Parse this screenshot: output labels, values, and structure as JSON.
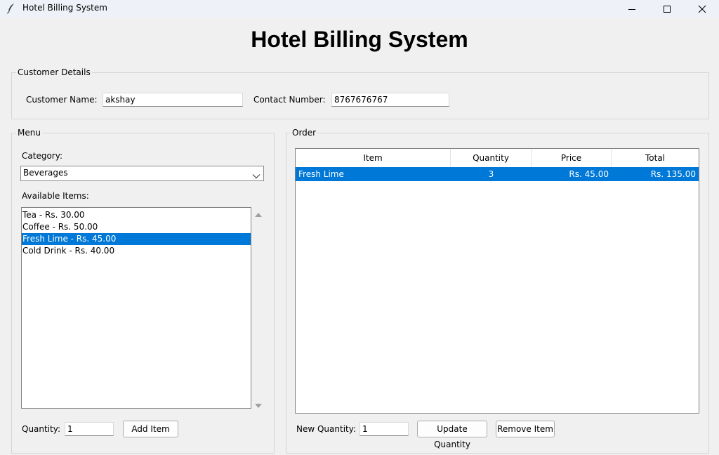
{
  "window": {
    "title": "Hotel Billing System"
  },
  "heading": "Hotel Billing System",
  "customer": {
    "group_label": "Customer Details",
    "name_label": "Customer Name:",
    "name_value": "akshay",
    "contact_label": "Contact Number:",
    "contact_value": "8767676767"
  },
  "menu": {
    "group_label": "Menu",
    "category_label": "Category:",
    "category_value": "Beverages",
    "available_label": "Available Items:",
    "items": [
      "Tea - Rs. 30.00",
      "Coffee - Rs. 50.00",
      "Fresh Lime - Rs. 45.00",
      "Cold Drink - Rs. 40.00"
    ],
    "selected_index": 2,
    "quantity_label": "Quantity:",
    "quantity_value": "1",
    "add_button": "Add Item"
  },
  "order": {
    "group_label": "Order",
    "columns": [
      "Item",
      "Quantity",
      "Price",
      "Total"
    ],
    "rows": [
      {
        "item": "Fresh Lime",
        "quantity": "3",
        "price": "Rs. 45.00",
        "total": "Rs. 135.00"
      }
    ],
    "new_quantity_label": "New Quantity:",
    "new_quantity_value": "1",
    "update_button": "Update Quantity",
    "remove_button": "Remove Item"
  },
  "colors": {
    "selection": "#0078d7",
    "window_bg": "#f0f0f0",
    "titlebar_bg": "#eef2f8"
  },
  "icons": [
    "feather-icon",
    "minimize-icon",
    "maximize-icon",
    "close-icon",
    "chevron-down-icon",
    "scroll-up-arrow-icon",
    "scroll-down-arrow-icon"
  ]
}
